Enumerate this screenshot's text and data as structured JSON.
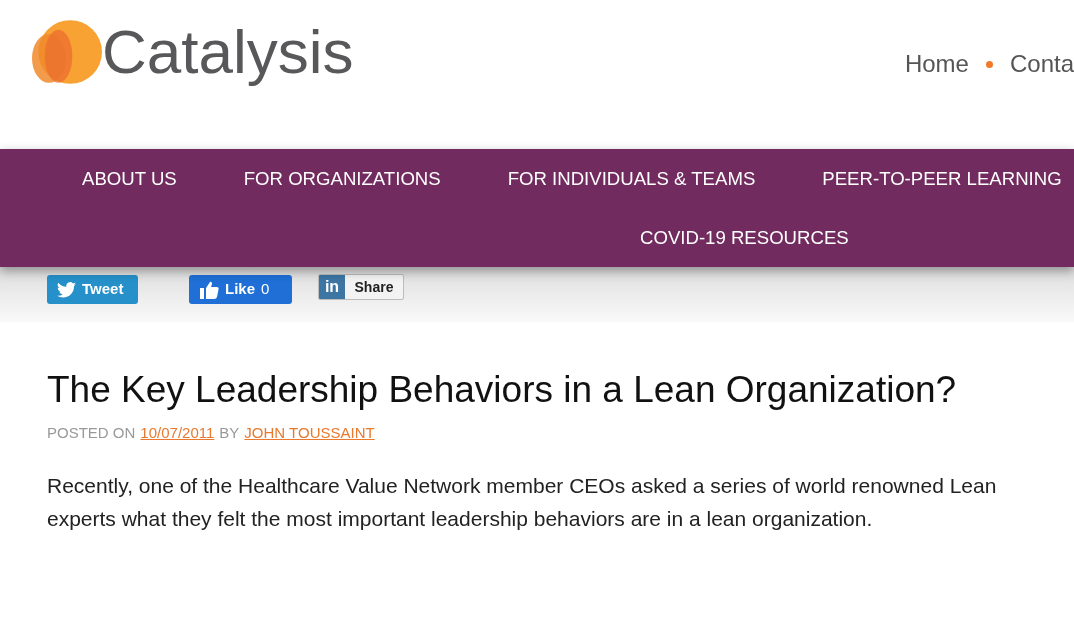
{
  "logo": {
    "text": "Catalysis"
  },
  "top_nav": {
    "items": [
      {
        "label": "Home"
      },
      {
        "label": "Conta"
      }
    ]
  },
  "main_nav": {
    "items": [
      {
        "label": "ABOUT US"
      },
      {
        "label": "FOR ORGANIZATIONS"
      },
      {
        "label": "FOR INDIVIDUALS & TEAMS"
      },
      {
        "label": "PEER-TO-PEER LEARNING"
      },
      {
        "label": "COVID-19 RESOURCES"
      }
    ]
  },
  "social_buttons": [
    {
      "kind": "tweet",
      "label": "Tweet"
    },
    {
      "kind": "like",
      "label": "Like",
      "count": "0"
    },
    {
      "kind": "share",
      "badge": "in",
      "label": "Share"
    }
  ],
  "article": {
    "title": "The Key Leadership Behaviors in a Lean Organization?",
    "meta": {
      "posted_on": "POSTED ON",
      "date": "10/07/2011",
      "by": "BY",
      "author": "JOHN TOUSSAINT"
    },
    "body": "Recently, one of the Healthcare Value Network member CEOs asked a series of world renowned Lean experts what they felt the most important leadership behaviors are in a lean organization."
  }
}
